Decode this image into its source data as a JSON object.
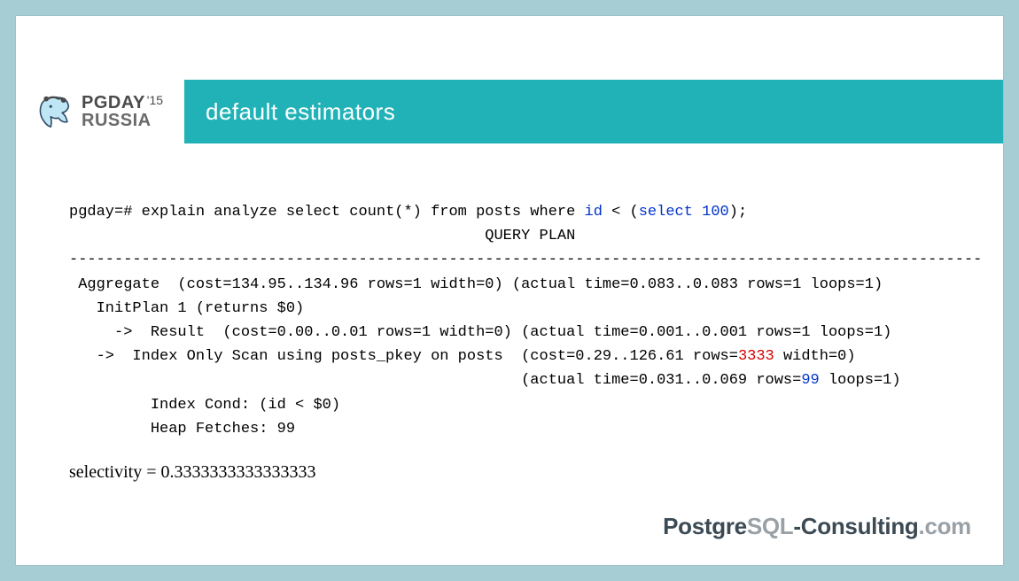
{
  "logo": {
    "line1_main": "PGDAY",
    "line1_tick": "'15",
    "line2": "RUSSIA"
  },
  "header": {
    "title": "default estimators"
  },
  "code": {
    "prompt": "pgday=# ",
    "cmd_pre": "explain analyze select count(*) from posts where ",
    "cmd_id": "id",
    "cmd_lt": " < (",
    "cmd_select": "select",
    "cmd_100": " 100",
    "cmd_post": ");",
    "qp_label": "                                              QUERY PLAN",
    "dash": "-----------------------------------------------------------------------------------------------------",
    "l1": " Aggregate  (cost=134.95..134.96 rows=1 width=0) (actual time=0.083..0.083 rows=1 loops=1)",
    "l2": "   InitPlan 1 (returns $0)",
    "l3": "     ->  Result  (cost=0.00..0.01 rows=1 width=0) (actual time=0.001..0.001 rows=1 loops=1)",
    "l4_pre": "   ->  Index Only Scan using posts_pkey on posts  (cost=0.29..126.61 rows=",
    "l4_rows": "3333",
    "l4_post": " width=0)",
    "l5_pre": "                                                  (actual time=0.031..0.069 rows=",
    "l5_rows": "99",
    "l5_post": " loops=1)",
    "l6": "         Index Cond: (id < $0)",
    "l7": "         Heap Fetches: 99"
  },
  "selectivity": "selectivity = 0.3333333333333333",
  "footer": {
    "p1": "Postgre",
    "p2": "SQL",
    "p3": "-Consulting",
    "p4": ".com"
  }
}
